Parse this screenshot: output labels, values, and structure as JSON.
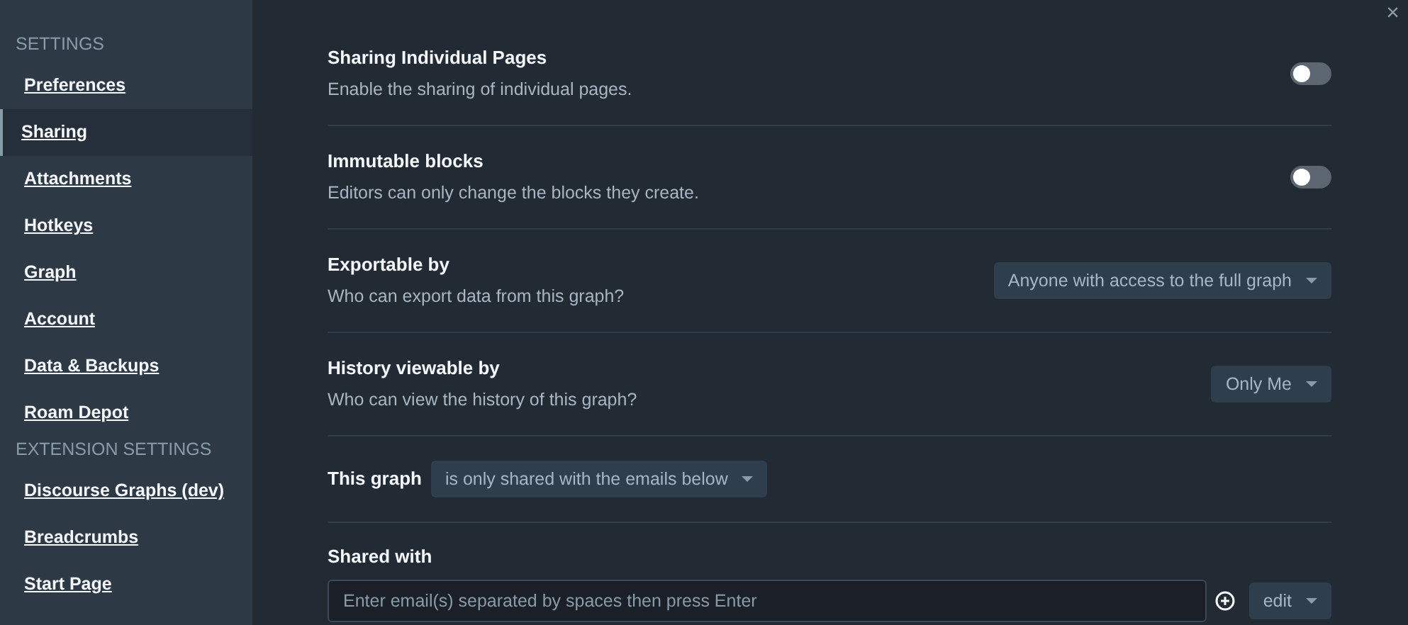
{
  "sidebar": {
    "groups": [
      {
        "heading": "SETTINGS",
        "items": [
          {
            "label": "Preferences",
            "selected": false
          },
          {
            "label": "Sharing",
            "selected": true
          },
          {
            "label": "Attachments",
            "selected": false
          },
          {
            "label": "Hotkeys",
            "selected": false
          },
          {
            "label": "Graph",
            "selected": false
          },
          {
            "label": "Account",
            "selected": false
          },
          {
            "label": "Data & Backups",
            "selected": false
          },
          {
            "label": "Roam Depot",
            "selected": false
          }
        ]
      },
      {
        "heading": "EXTENSION SETTINGS",
        "items": [
          {
            "label": "Discourse Graphs (dev)",
            "selected": false
          },
          {
            "label": "Breadcrumbs",
            "selected": false
          },
          {
            "label": "Start Page",
            "selected": false
          }
        ]
      }
    ]
  },
  "close": "×",
  "settings": [
    {
      "kind": "toggle",
      "title": "Sharing Individual Pages",
      "description": "Enable the sharing of individual pages.",
      "on": false
    },
    {
      "kind": "toggle",
      "title": "Immutable blocks",
      "description": "Editors can only change the blocks they create.",
      "on": false
    },
    {
      "kind": "select",
      "title": "Exportable by",
      "description": "Who can export data from this graph?",
      "value": "Anyone with access to the full graph"
    },
    {
      "kind": "select",
      "title": "History viewable by",
      "description": "Who can view the history of this graph?",
      "value": "Only Me"
    },
    {
      "kind": "inline-select",
      "title": "This graph",
      "value": "is only shared with the emails below"
    },
    {
      "kind": "email",
      "title": "Shared with",
      "placeholder": "Enter email(s) separated by spaces then press Enter",
      "value": "edit"
    }
  ]
}
